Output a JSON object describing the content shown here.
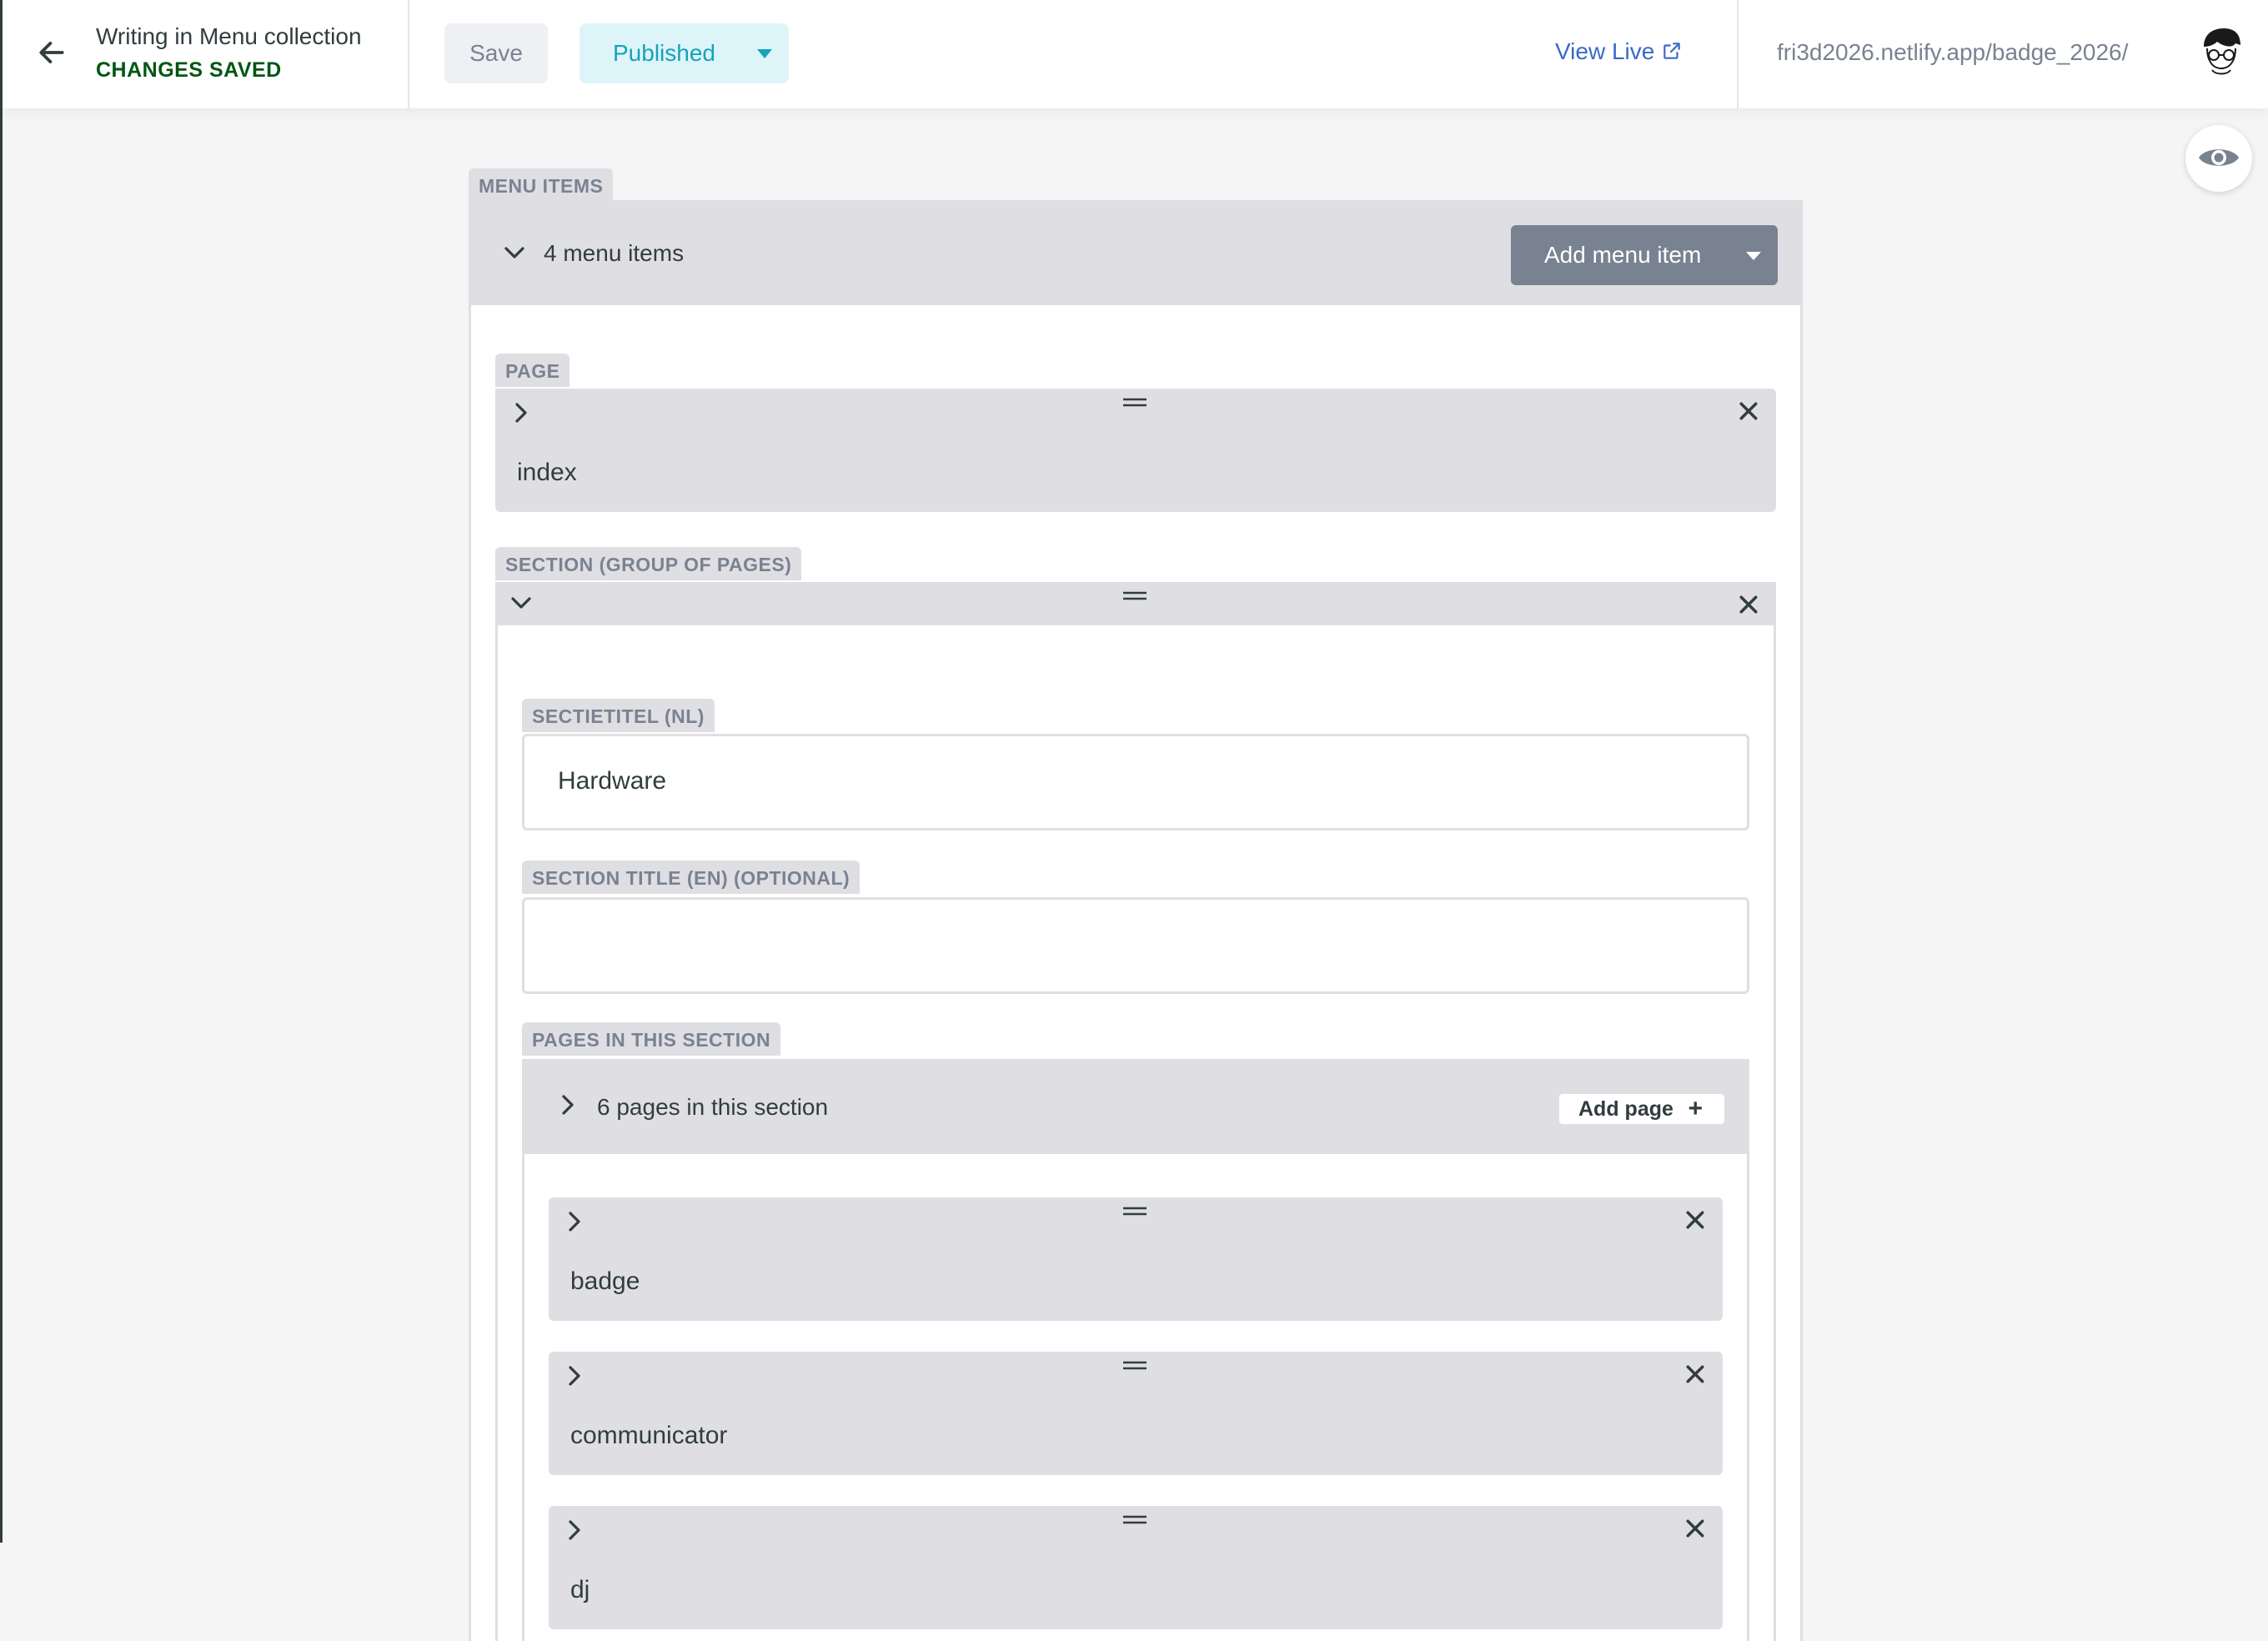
{
  "header": {
    "back_title": "Writing in Menu collection",
    "status": "CHANGES SAVED",
    "save_label": "Save",
    "publish_label": "Published",
    "view_live_label": "View Live",
    "site_url": "fri3d2026.netlify.app/badge_2026/"
  },
  "editor": {
    "menu_items": {
      "label": "MENU ITEMS",
      "summary": "4 menu items",
      "add_label": "Add menu item"
    },
    "page_item": {
      "label": "PAGE",
      "value": "index"
    },
    "section_item": {
      "label": "SECTION (GROUP OF PAGES)",
      "title_nl_label": "SECTIETITEL (NL)",
      "title_nl_value": "Hardware",
      "title_en_label": "SECTION TITLE (EN) (OPTIONAL)",
      "title_en_value": "",
      "pages_label": "PAGES IN THIS SECTION",
      "pages_summary": "6 pages in this section",
      "add_page_label": "Add page",
      "add_page_plus": "+",
      "pages": [
        "badge",
        "communicator",
        "dj"
      ]
    }
  },
  "colors": {
    "status_saved": "#005614",
    "published": "#17a2b8",
    "link": "#3a69c7",
    "card_bg": "#dfdfe3"
  },
  "icons": [
    "arrow-left-icon",
    "caret-down-icon",
    "external-link-icon",
    "avatar-icon",
    "eye-icon",
    "chevron-down-icon",
    "chevron-right-icon",
    "drag-handle-icon",
    "close-icon",
    "plus-icon"
  ]
}
